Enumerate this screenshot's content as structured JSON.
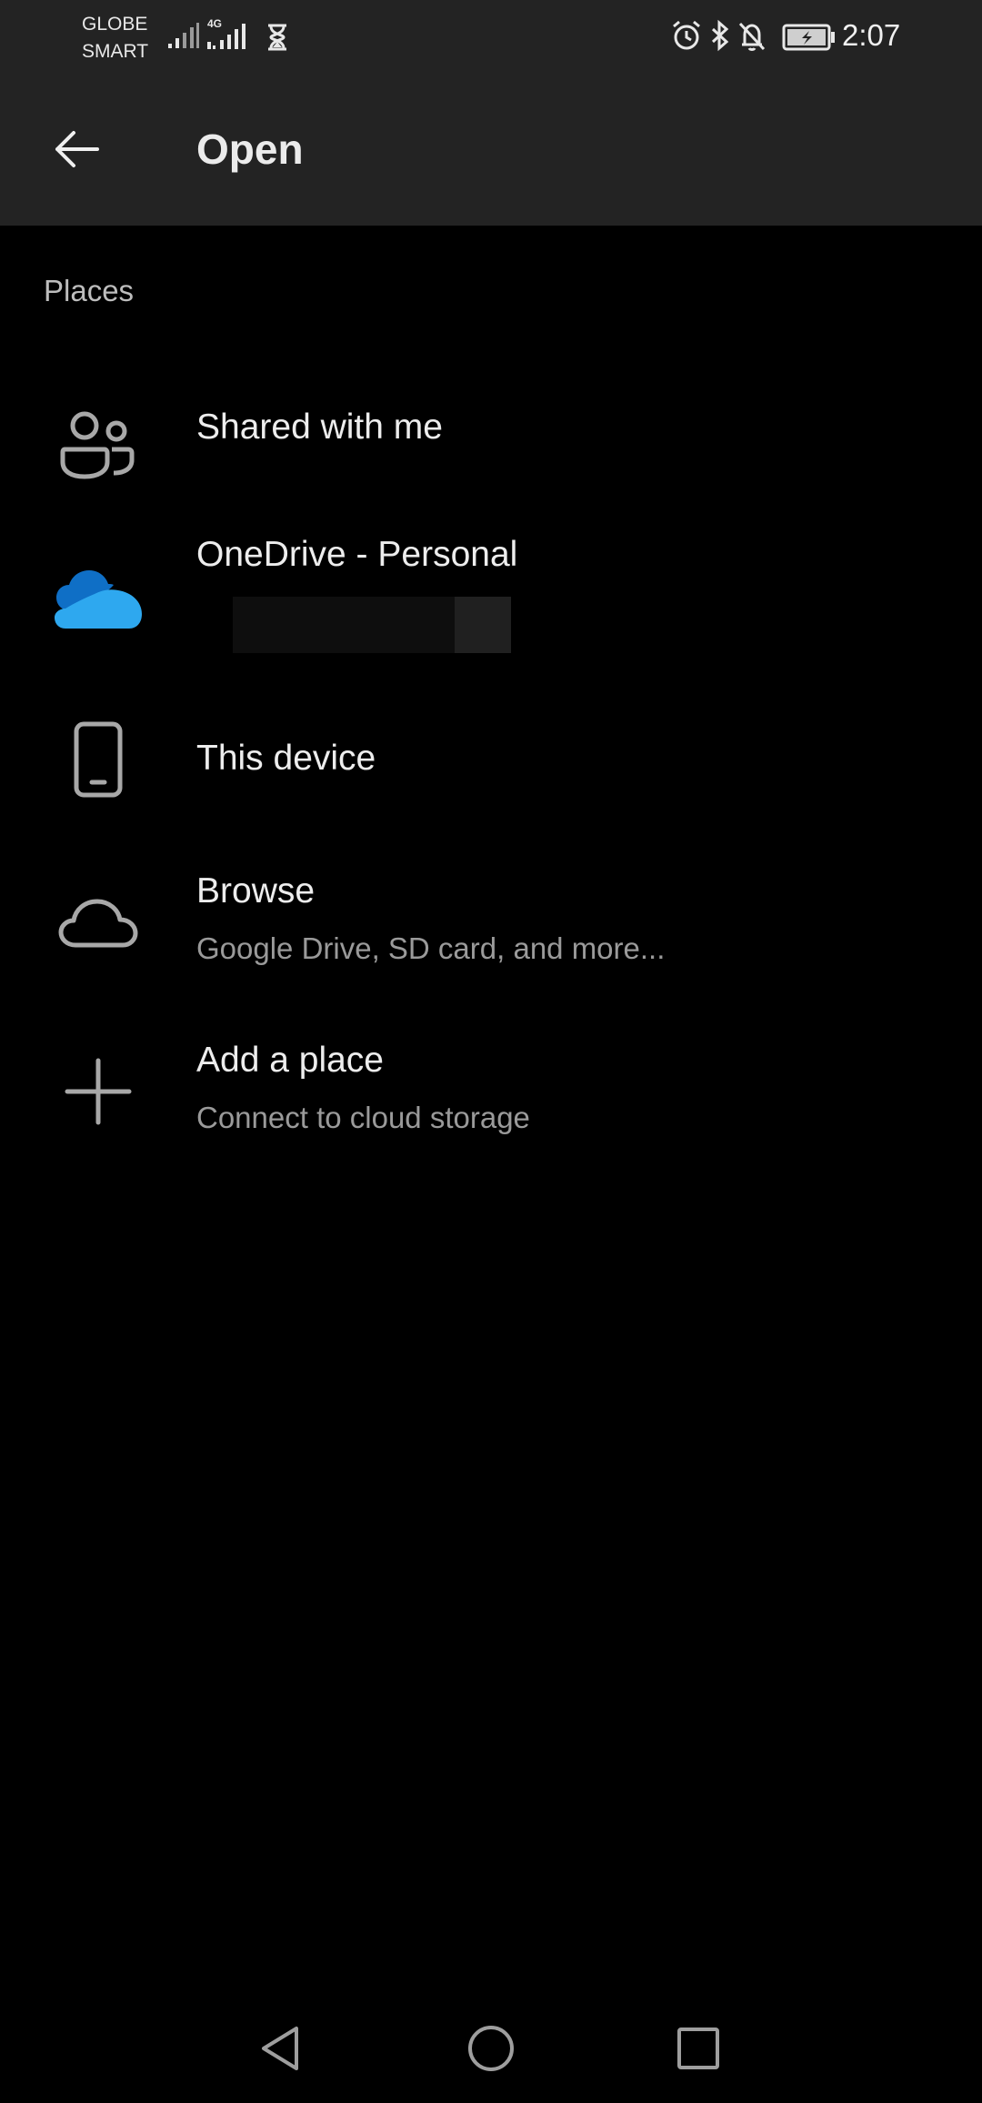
{
  "status_bar": {
    "carrier_line1": "GLOBE",
    "carrier_line2": "SMART",
    "network_type": "4G",
    "time": "2:07",
    "icons": [
      "signal-icon",
      "signal-4g-icon",
      "hourglass-icon",
      "alarm-icon",
      "bluetooth-icon",
      "bell-off-icon",
      "battery-charging-icon"
    ]
  },
  "app_bar": {
    "back_icon": "arrow-left-icon",
    "title": "Open"
  },
  "places": {
    "header": "Places",
    "items": [
      {
        "icon": "people-icon",
        "title": "Shared with me",
        "subtitle": ""
      },
      {
        "icon": "onedrive-cloud-icon",
        "title": "OneDrive - Personal",
        "subtitle": ""
      },
      {
        "icon": "phone-icon",
        "title": "This device",
        "subtitle": ""
      },
      {
        "icon": "cloud-outline-icon",
        "title": "Browse",
        "subtitle": "Google Drive, SD card, and more..."
      },
      {
        "icon": "plus-icon",
        "title": "Add a place",
        "subtitle": "Connect to cloud storage"
      }
    ]
  },
  "nav_bar": {
    "icons": [
      "nav-back-icon",
      "nav-home-icon",
      "nav-recents-icon"
    ]
  },
  "colors": {
    "background": "#000000",
    "bar": "#232323",
    "icon_gray": "#a8a8a8",
    "onedrive_dark": "#0f6fc6",
    "onedrive_light": "#2ea8ef"
  }
}
